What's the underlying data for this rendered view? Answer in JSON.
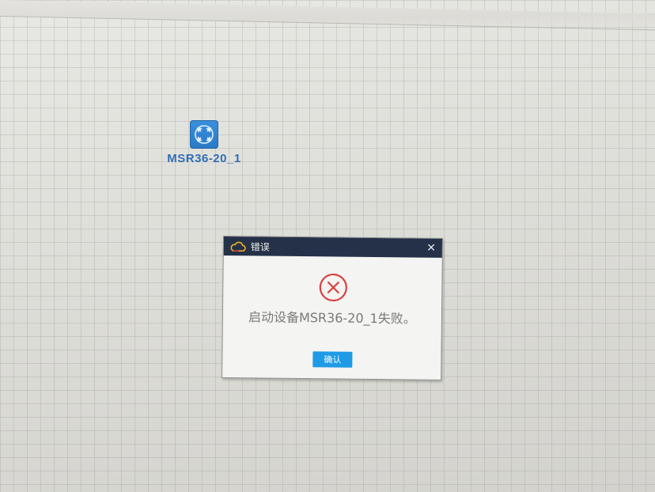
{
  "device": {
    "label": "MSR36-20_1",
    "icon": "router-icon"
  },
  "dialog": {
    "title": "错误",
    "title_icon": "cloud-icon",
    "close_label": "✕",
    "status_icon": "error-circle-icon",
    "message": "启动设备MSR36-20_1失败。",
    "ok_label": "确认"
  },
  "colors": {
    "titlebar": "#243149",
    "button": "#1e9be6",
    "error": "#d9423f",
    "device_icon": "#2a79c6",
    "device_label": "#2f6fb6"
  }
}
